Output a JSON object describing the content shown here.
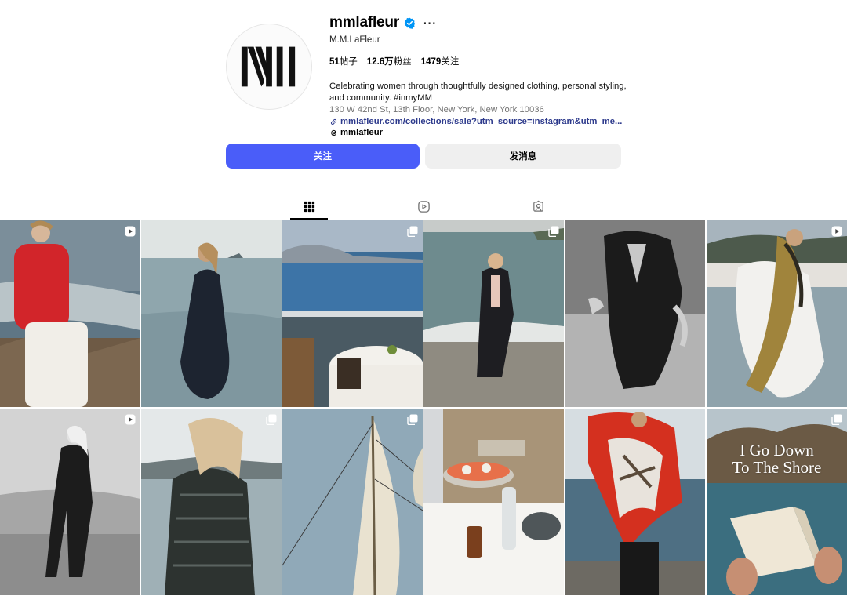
{
  "profile": {
    "username": "mmlafleur",
    "more_label": "···",
    "full_name": "M.M.LaFleur",
    "stats": {
      "posts_count": "51",
      "posts_label": "帖子",
      "followers_count": "12.6万",
      "followers_label": "粉丝",
      "following_count": "1479",
      "following_label": "关注"
    },
    "bio": "Celebrating women through thoughtfully designed clothing, personal styling, and community. #inmyMM",
    "address": "130 W 42nd St, 13th Floor, New York, New York 10036",
    "link": "mmlafleur.com/collections/sale?utm_source=instagram&utm_me...",
    "threads_handle": "mmlafleur"
  },
  "buttons": {
    "follow": "关注",
    "message": "发消息"
  },
  "tabs": [
    {
      "name": "posts",
      "icon": "grid-icon",
      "active": true
    },
    {
      "name": "reels",
      "icon": "reels-icon",
      "active": false
    },
    {
      "name": "tagged",
      "icon": "tagged-icon",
      "active": false
    }
  ],
  "posts": [
    {
      "badge": "reel-icon",
      "caption": ""
    },
    {
      "badge": "",
      "caption": ""
    },
    {
      "badge": "carousel-icon",
      "caption": ""
    },
    {
      "badge": "carousel-icon",
      "caption": ""
    },
    {
      "badge": "",
      "caption": ""
    },
    {
      "badge": "reel-icon",
      "caption": ""
    },
    {
      "badge": "reel-icon",
      "caption": ""
    },
    {
      "badge": "carousel-icon",
      "caption": ""
    },
    {
      "badge": "carousel-icon",
      "caption": ""
    },
    {
      "badge": "",
      "caption": ""
    },
    {
      "badge": "",
      "caption": ""
    },
    {
      "badge": "carousel-icon",
      "caption_line1": "I Go Down",
      "caption_line2": "To The Shore"
    }
  ],
  "colors": {
    "follow_button": "#4a5df9",
    "message_button": "#efefef",
    "verified_badge": "#0095f6",
    "link": "#2d3a8c"
  }
}
